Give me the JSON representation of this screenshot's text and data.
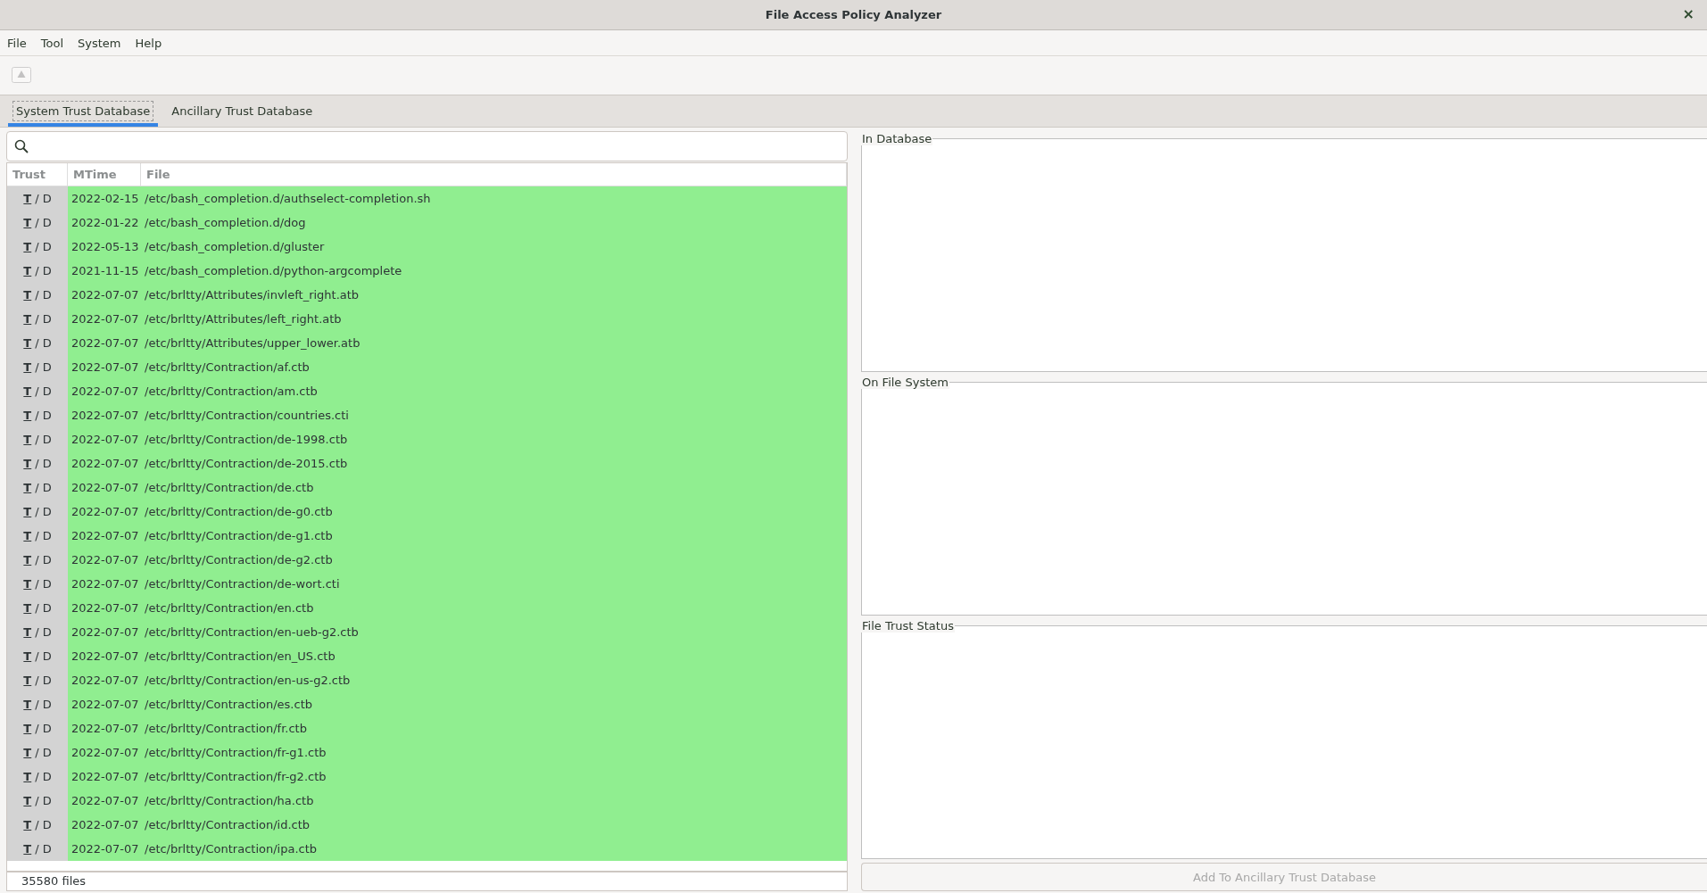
{
  "window": {
    "title": "File Access Policy Analyzer",
    "close": "×"
  },
  "menu": [
    {
      "label": "File"
    },
    {
      "label": "Tool"
    },
    {
      "label": "System"
    },
    {
      "label": "Help"
    }
  ],
  "toolbar": [
    {
      "kind": "warning",
      "disabled": true
    }
  ],
  "tabs": [
    {
      "label": "System Trust Database",
      "selected": true
    },
    {
      "label": "Ancillary Trust Database",
      "selected": false
    }
  ],
  "table": {
    "columns": [
      "Trust",
      "MTime",
      "File"
    ],
    "rows": [
      {
        "trust": [
          {
            "label": "T",
            "selected": true
          },
          {
            "label": "D",
            "selected": false
          }
        ],
        "separator": "/",
        "mtime": "2022-02-15",
        "file": "/etc/bash_completion.d/authselect-completion.sh"
      },
      {
        "trust": [
          {
            "label": "T",
            "selected": true
          },
          {
            "label": "D",
            "selected": false
          }
        ],
        "separator": "/",
        "mtime": "2022-01-22",
        "file": "/etc/bash_completion.d/dog"
      },
      {
        "trust": [
          {
            "label": "T",
            "selected": true
          },
          {
            "label": "D",
            "selected": false
          }
        ],
        "separator": "/",
        "mtime": "2022-05-13",
        "file": "/etc/bash_completion.d/gluster"
      },
      {
        "trust": [
          {
            "label": "T",
            "selected": true
          },
          {
            "label": "D",
            "selected": false
          }
        ],
        "separator": "/",
        "mtime": "2021-11-15",
        "file": "/etc/bash_completion.d/python-argcomplete"
      },
      {
        "trust": [
          {
            "label": "T",
            "selected": true
          },
          {
            "label": "D",
            "selected": false
          }
        ],
        "separator": "/",
        "mtime": "2022-07-07",
        "file": "/etc/brltty/Attributes/invleft_right.atb"
      },
      {
        "trust": [
          {
            "label": "T",
            "selected": true
          },
          {
            "label": "D",
            "selected": false
          }
        ],
        "separator": "/",
        "mtime": "2022-07-07",
        "file": "/etc/brltty/Attributes/left_right.atb"
      },
      {
        "trust": [
          {
            "label": "T",
            "selected": true
          },
          {
            "label": "D",
            "selected": false
          }
        ],
        "separator": "/",
        "mtime": "2022-07-07",
        "file": "/etc/brltty/Attributes/upper_lower.atb"
      },
      {
        "trust": [
          {
            "label": "T",
            "selected": true
          },
          {
            "label": "D",
            "selected": false
          }
        ],
        "separator": "/",
        "mtime": "2022-07-07",
        "file": "/etc/brltty/Contraction/af.ctb"
      },
      {
        "trust": [
          {
            "label": "T",
            "selected": true
          },
          {
            "label": "D",
            "selected": false
          }
        ],
        "separator": "/",
        "mtime": "2022-07-07",
        "file": "/etc/brltty/Contraction/am.ctb"
      },
      {
        "trust": [
          {
            "label": "T",
            "selected": true
          },
          {
            "label": "D",
            "selected": false
          }
        ],
        "separator": "/",
        "mtime": "2022-07-07",
        "file": "/etc/brltty/Contraction/countries.cti"
      },
      {
        "trust": [
          {
            "label": "T",
            "selected": true
          },
          {
            "label": "D",
            "selected": false
          }
        ],
        "separator": "/",
        "mtime": "2022-07-07",
        "file": "/etc/brltty/Contraction/de-1998.ctb"
      },
      {
        "trust": [
          {
            "label": "T",
            "selected": true
          },
          {
            "label": "D",
            "selected": false
          }
        ],
        "separator": "/",
        "mtime": "2022-07-07",
        "file": "/etc/brltty/Contraction/de-2015.ctb"
      },
      {
        "trust": [
          {
            "label": "T",
            "selected": true
          },
          {
            "label": "D",
            "selected": false
          }
        ],
        "separator": "/",
        "mtime": "2022-07-07",
        "file": "/etc/brltty/Contraction/de.ctb"
      },
      {
        "trust": [
          {
            "label": "T",
            "selected": true
          },
          {
            "label": "D",
            "selected": false
          }
        ],
        "separator": "/",
        "mtime": "2022-07-07",
        "file": "/etc/brltty/Contraction/de-g0.ctb"
      },
      {
        "trust": [
          {
            "label": "T",
            "selected": true
          },
          {
            "label": "D",
            "selected": false
          }
        ],
        "separator": "/",
        "mtime": "2022-07-07",
        "file": "/etc/brltty/Contraction/de-g1.ctb"
      },
      {
        "trust": [
          {
            "label": "T",
            "selected": true
          },
          {
            "label": "D",
            "selected": false
          }
        ],
        "separator": "/",
        "mtime": "2022-07-07",
        "file": "/etc/brltty/Contraction/de-g2.ctb"
      },
      {
        "trust": [
          {
            "label": "T",
            "selected": true
          },
          {
            "label": "D",
            "selected": false
          }
        ],
        "separator": "/",
        "mtime": "2022-07-07",
        "file": "/etc/brltty/Contraction/de-wort.cti"
      },
      {
        "trust": [
          {
            "label": "T",
            "selected": true
          },
          {
            "label": "D",
            "selected": false
          }
        ],
        "separator": "/",
        "mtime": "2022-07-07",
        "file": "/etc/brltty/Contraction/en.ctb"
      },
      {
        "trust": [
          {
            "label": "T",
            "selected": true
          },
          {
            "label": "D",
            "selected": false
          }
        ],
        "separator": "/",
        "mtime": "2022-07-07",
        "file": "/etc/brltty/Contraction/en-ueb-g2.ctb"
      },
      {
        "trust": [
          {
            "label": "T",
            "selected": true
          },
          {
            "label": "D",
            "selected": false
          }
        ],
        "separator": "/",
        "mtime": "2022-07-07",
        "file": "/etc/brltty/Contraction/en_US.ctb"
      },
      {
        "trust": [
          {
            "label": "T",
            "selected": true
          },
          {
            "label": "D",
            "selected": false
          }
        ],
        "separator": "/",
        "mtime": "2022-07-07",
        "file": "/etc/brltty/Contraction/en-us-g2.ctb"
      },
      {
        "trust": [
          {
            "label": "T",
            "selected": true
          },
          {
            "label": "D",
            "selected": false
          }
        ],
        "separator": "/",
        "mtime": "2022-07-07",
        "file": "/etc/brltty/Contraction/es.ctb"
      },
      {
        "trust": [
          {
            "label": "T",
            "selected": true
          },
          {
            "label": "D",
            "selected": false
          }
        ],
        "separator": "/",
        "mtime": "2022-07-07",
        "file": "/etc/brltty/Contraction/fr.ctb"
      },
      {
        "trust": [
          {
            "label": "T",
            "selected": true
          },
          {
            "label": "D",
            "selected": false
          }
        ],
        "separator": "/",
        "mtime": "2022-07-07",
        "file": "/etc/brltty/Contraction/fr-g1.ctb"
      },
      {
        "trust": [
          {
            "label": "T",
            "selected": true
          },
          {
            "label": "D",
            "selected": false
          }
        ],
        "separator": "/",
        "mtime": "2022-07-07",
        "file": "/etc/brltty/Contraction/fr-g2.ctb"
      },
      {
        "trust": [
          {
            "label": "T",
            "selected": true
          },
          {
            "label": "D",
            "selected": false
          }
        ],
        "separator": "/",
        "mtime": "2022-07-07",
        "file": "/etc/brltty/Contraction/ha.ctb"
      },
      {
        "trust": [
          {
            "label": "T",
            "selected": true
          },
          {
            "label": "D",
            "selected": false
          }
        ],
        "separator": "/",
        "mtime": "2022-07-07",
        "file": "/etc/brltty/Contraction/id.ctb"
      },
      {
        "trust": [
          {
            "label": "T",
            "selected": true
          },
          {
            "label": "D",
            "selected": false
          }
        ],
        "separator": "/",
        "mtime": "2022-07-07",
        "file": "/etc/brltty/Contraction/ipa.ctb"
      }
    ]
  },
  "status_bar": {
    "count": "35580 files"
  },
  "details": {
    "groups": [
      {
        "title": "In Database"
      },
      {
        "title": "On File System"
      },
      {
        "title": "File Trust Status"
      }
    ],
    "button": {
      "label": "Add To Ancillary Trust Database",
      "disabled": true
    }
  }
}
